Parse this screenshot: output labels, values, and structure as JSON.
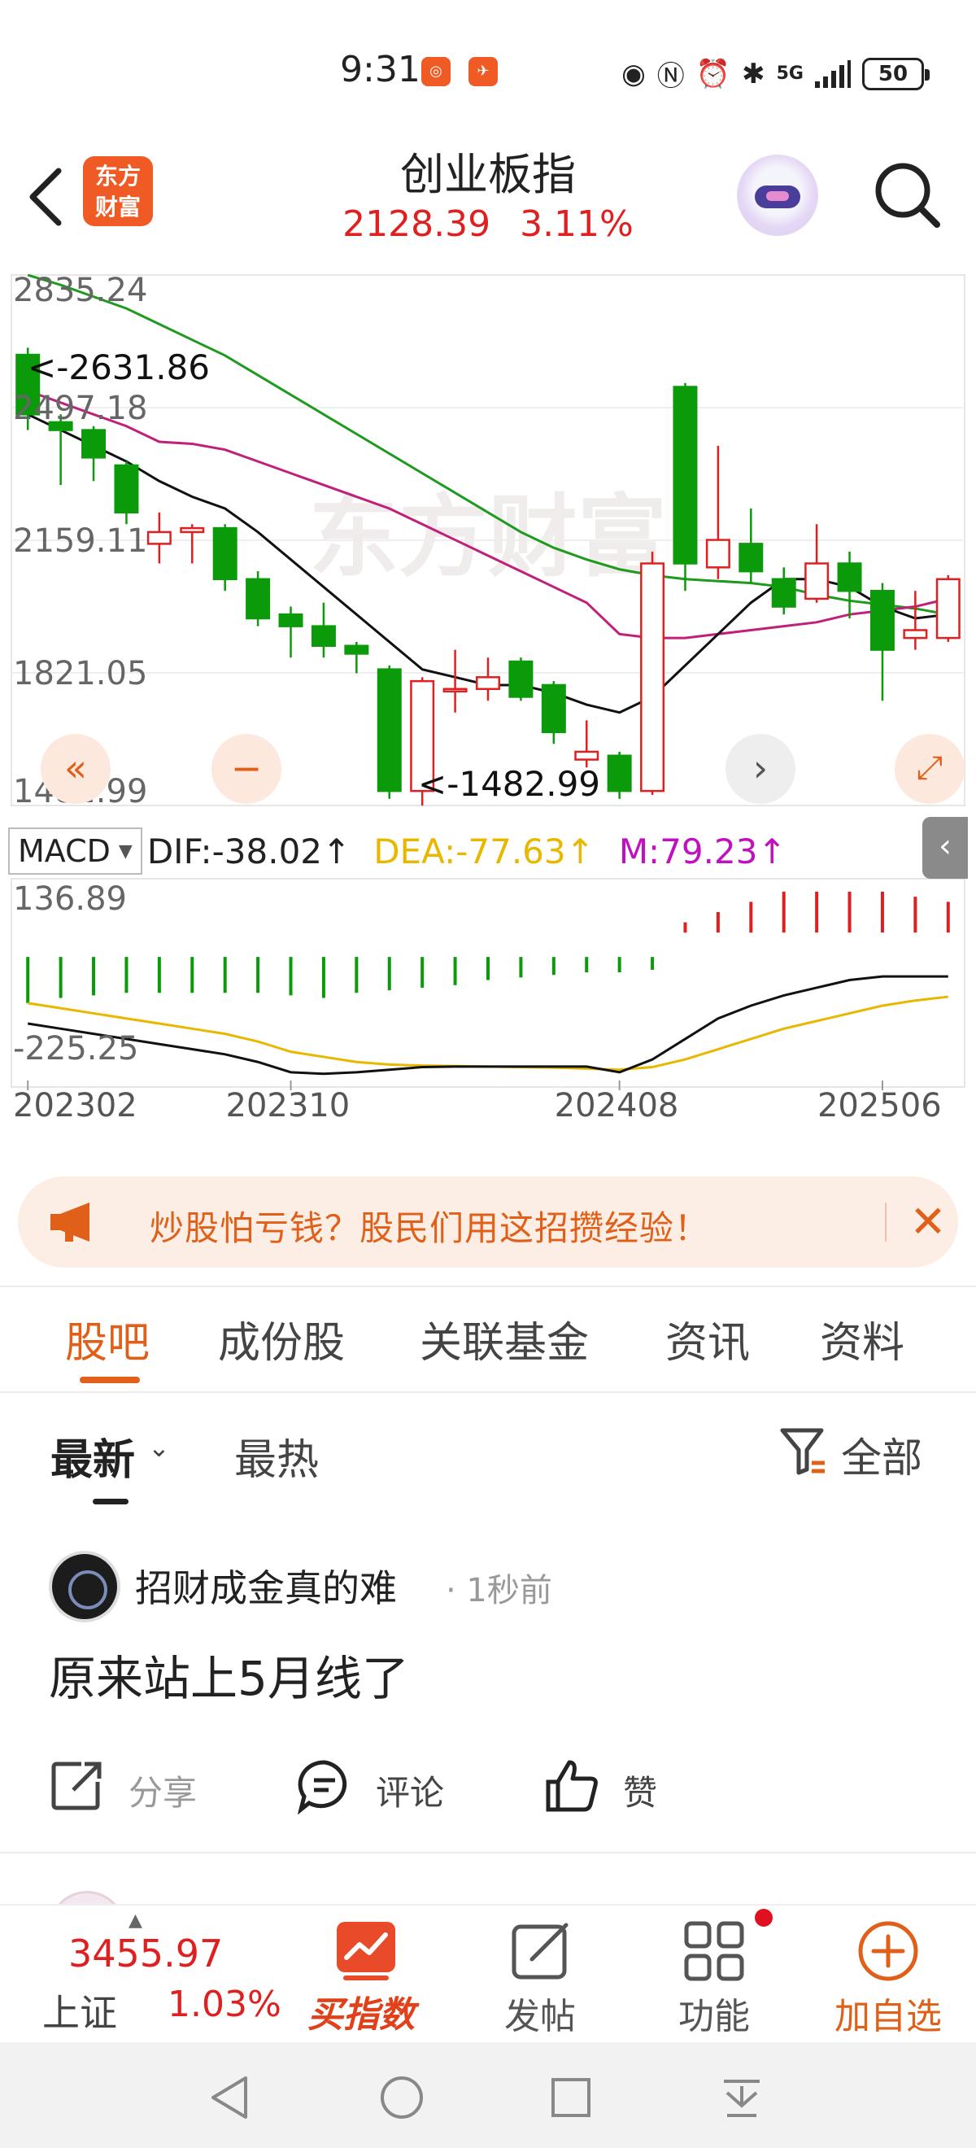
{
  "status_bar": {
    "time": "9:31",
    "app_icons": [
      "app-notify-icon-1",
      "app-notify-icon-2"
    ],
    "right_icons": [
      "eye-icon",
      "nfc-icon",
      "alarm-icon",
      "bluetooth-icon",
      "signal-5g-icon"
    ],
    "signal_label": "5G",
    "battery": "50"
  },
  "header": {
    "title": "创业板指",
    "price": "2128.39",
    "change_pct": "3.11%",
    "logo_text_1": "东方",
    "logo_text_2": "财富",
    "colors": {
      "up": "#e02020",
      "accent": "#e0601a"
    }
  },
  "chart_data": {
    "type": "candlestick",
    "watermark": "东方财富",
    "y_ticks": [
      "2835.24",
      "2497.18",
      "2159.11",
      "1821.05",
      "1482.99"
    ],
    "ylim": [
      1482.99,
      2835.24
    ],
    "annotations": [
      {
        "text": "<-2631.86",
        "value": 2631.86
      },
      {
        "text": "<-1482.99",
        "value": 1482.99
      }
    ],
    "x_ticks": [
      "202302",
      "202310",
      "202408",
      "202506"
    ],
    "candles": [
      {
        "o": 2631.86,
        "c": 2480.0,
        "h": 2650.0,
        "l": 2440.0
      },
      {
        "o": 2460.0,
        "c": 2440.0,
        "h": 2480.0,
        "l": 2300.0
      },
      {
        "o": 2440.0,
        "c": 2370.0,
        "h": 2450.0,
        "l": 2310.0
      },
      {
        "o": 2350.0,
        "c": 2230.0,
        "h": 2360.0,
        "l": 2200.0
      },
      {
        "o": 2150.0,
        "c": 2180.0,
        "h": 2230.0,
        "l": 2100.0
      },
      {
        "o": 2180.0,
        "c": 2190.0,
        "h": 2200.0,
        "l": 2100.0
      },
      {
        "o": 2190.0,
        "c": 2060.0,
        "h": 2200.0,
        "l": 2030.0
      },
      {
        "o": 2060.0,
        "c": 1960.0,
        "h": 2080.0,
        "l": 1940.0
      },
      {
        "o": 1970.0,
        "c": 1940.0,
        "h": 1990.0,
        "l": 1860.0
      },
      {
        "o": 1940.0,
        "c": 1890.0,
        "h": 2000.0,
        "l": 1860.0
      },
      {
        "o": 1890.0,
        "c": 1870.0,
        "h": 1900.0,
        "l": 1820.0
      },
      {
        "o": 1830.0,
        "c": 1520.0,
        "h": 1840.0,
        "l": 1500.0
      },
      {
        "o": 1520.0,
        "c": 1800.0,
        "h": 1810.0,
        "l": 1482.99
      },
      {
        "o": 1780.0,
        "c": 1780.0,
        "h": 1880.0,
        "l": 1720.0
      },
      {
        "o": 1780.0,
        "c": 1810.0,
        "h": 1860.0,
        "l": 1750.0
      },
      {
        "o": 1850.0,
        "c": 1760.0,
        "h": 1860.0,
        "l": 1750.0
      },
      {
        "o": 1790.0,
        "c": 1670.0,
        "h": 1800.0,
        "l": 1640.0
      },
      {
        "o": 1600.0,
        "c": 1620.0,
        "h": 1700.0,
        "l": 1580.0
      },
      {
        "o": 1610.0,
        "c": 1520.0,
        "h": 1620.0,
        "l": 1500.0
      },
      {
        "o": 1520.0,
        "c": 2100.0,
        "h": 2130.0,
        "l": 1510.0
      },
      {
        "o": 2550.0,
        "c": 2100.0,
        "h": 2560.0,
        "l": 2030.0
      },
      {
        "o": 2090.0,
        "c": 2160.0,
        "h": 2400.0,
        "l": 2060.0
      },
      {
        "o": 2150.0,
        "c": 2080.0,
        "h": 2240.0,
        "l": 2050.0
      },
      {
        "o": 2060.0,
        "c": 1990.0,
        "h": 2090.0,
        "l": 1970.0
      },
      {
        "o": 2010.0,
        "c": 2100.0,
        "h": 2200.0,
        "l": 2000.0
      },
      {
        "o": 2100.0,
        "c": 2030.0,
        "h": 2130.0,
        "l": 1960.0
      },
      {
        "o": 2030.0,
        "c": 1880.0,
        "h": 2050.0,
        "l": 1750.0
      },
      {
        "o": 1910.0,
        "c": 1930.0,
        "h": 2030.0,
        "l": 1880.0
      },
      {
        "o": 1910.0,
        "c": 2060.0,
        "h": 2070.0,
        "l": 1900.0
      }
    ],
    "ma_short": [
      2480,
      2440,
      2400,
      2360,
      2310,
      2270,
      2240,
      2180,
      2110,
      2040,
      1970,
      1900,
      1830,
      1810,
      1790,
      1790,
      1770,
      1740,
      1720,
      1760,
      1840,
      1920,
      2000,
      2060,
      2060,
      2040,
      1990,
      1960,
      1970
    ],
    "ma_mid": [
      2540,
      2510,
      2480,
      2450,
      2410,
      2405,
      2390,
      2360,
      2330,
      2300,
      2270,
      2240,
      2200,
      2160,
      2120,
      2080,
      2040,
      2000,
      1920,
      1910,
      1910,
      1920,
      1930,
      1940,
      1950,
      1970,
      1980,
      1990,
      2010
    ],
    "ma_long": [
      2835,
      2810,
      2780,
      2750,
      2710,
      2670,
      2630,
      2580,
      2530,
      2480,
      2430,
      2380,
      2330,
      2280,
      2230,
      2180,
      2140,
      2110,
      2085,
      2070,
      2060,
      2055,
      2050,
      2040,
      2020,
      2005,
      1995,
      1985,
      1970
    ],
    "colors": {
      "up": "#e02020",
      "down": "#0a9a0a",
      "ma_short": "#111111",
      "ma_mid": "#c0207a",
      "ma_long": "#1e9a1e"
    },
    "grid": true
  },
  "macd": {
    "selector_label": "MACD",
    "dif": "DIF:-38.02↑",
    "dea": "DEA:-77.63↑",
    "m": "M:79.23↑",
    "y_ticks": [
      "136.89",
      "-225.25"
    ],
    "ylim": [
      -225.25,
      136.89
    ],
    "hist": [
      -90,
      -80,
      -75,
      -70,
      -70,
      -70,
      -70,
      -70,
      -75,
      -80,
      -70,
      -65,
      -60,
      -55,
      -45,
      -40,
      -35,
      -30,
      -30,
      -25,
      20,
      40,
      60,
      80,
      80,
      80,
      80,
      70,
      60
    ],
    "dif_line": [
      -130,
      -140,
      -150,
      -160,
      -170,
      -180,
      -190,
      -205,
      -225,
      -228,
      -225,
      -220,
      -215,
      -214,
      -214,
      -214,
      -214,
      -214,
      -225,
      -200,
      -160,
      -120,
      -95,
      -75,
      -60,
      -45,
      -38,
      -38,
      -38
    ],
    "dea_line": [
      -90,
      -100,
      -110,
      -120,
      -130,
      -140,
      -150,
      -165,
      -185,
      -195,
      -205,
      -210,
      -212,
      -213,
      -214,
      -215,
      -216,
      -218,
      -220,
      -215,
      -200,
      -180,
      -160,
      -140,
      -125,
      -110,
      -95,
      -85,
      -77.63
    ]
  },
  "chart_controls": [
    "double-left-icon",
    "zoom-out-icon",
    "prev-icon",
    "next-icon",
    "expand-icon"
  ],
  "ad": {
    "text": "炒股怕亏钱？股民们用这招攒经验！"
  },
  "tabs": [
    {
      "label": "股吧",
      "active": true
    },
    {
      "label": "成份股"
    },
    {
      "label": "关联基金"
    },
    {
      "label": "资讯"
    },
    {
      "label": "资料"
    }
  ],
  "sort": {
    "latest": "最新",
    "hot": "最热",
    "filter": "全部"
  },
  "post": {
    "user": "招财成金真的难",
    "time": "· 1秒前",
    "content": "原来站上5月线了",
    "share": "分享",
    "comment": "评论",
    "like": "赞"
  },
  "bottom_nav": {
    "index_value": "3455.97",
    "index_name": "上证",
    "index_pct": "1.03%",
    "buy_label": "买指数",
    "post_label": "发帖",
    "func_label": "功能",
    "add_label": "加自选"
  }
}
